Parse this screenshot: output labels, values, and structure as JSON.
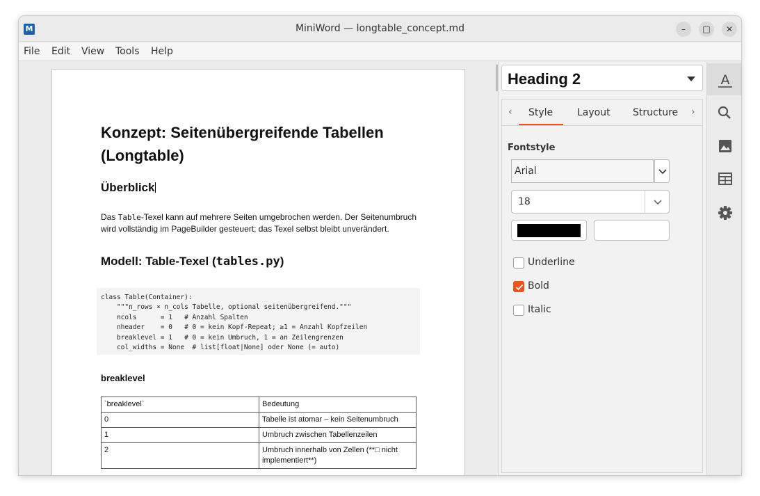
{
  "window": {
    "title": "MiniWord — longtable_concept.md",
    "app_icon_letter": "M",
    "minimize_symbol": "–",
    "maximize_symbol": "□",
    "close_symbol": "✕"
  },
  "menu": {
    "items": [
      "File",
      "Edit",
      "View",
      "Tools",
      "Help"
    ]
  },
  "document": {
    "title": "Konzept: Seitenübergreifende Tabellen (Longtable)",
    "heading_overview": "Überblick",
    "para_1": "Das ",
    "para_code": "Table",
    "para_2": "-Texel kann auf mehrere Seiten umgebrochen werden. Der Seitenumbruch wird vollständig im PageBuilder gesteuert; das Texel selbst bleibt unverändert.",
    "heading_model_prefix": "Modell: Table-Texel (",
    "heading_model_code": "tables.py",
    "heading_model_suffix": ")",
    "code_block": "class Table(Container):\n    \"\"\"n_rows × n_cols Tabelle, optional seitenübergreifend.\"\"\"\n    ncols      = 1   # Anzahl Spalten\n    nheader    = 0   # 0 = kein Kopf-Repeat; ≥1 = Anzahl Kopfzeilen\n    breaklevel = 1   # 0 = kein Umbruch, 1 = an Zeilengrenzen\n    col_widths = None  # list[float|None] oder None (= auto)",
    "heading_breaklevel": "breaklevel",
    "table": {
      "header": [
        "`breaklevel`",
        "Bedeutung"
      ],
      "rows": [
        [
          "0",
          "Tabelle ist atomar – kein Seitenumbruch"
        ],
        [
          "1",
          "Umbruch zwischen Tabellenzeilen"
        ],
        [
          "2",
          "Umbruch innerhalb von Zellen (**□ nicht implementiert**)"
        ]
      ]
    }
  },
  "panel": {
    "paragraph_style": "Heading 2",
    "tabs": [
      "Style",
      "Layout",
      "Structure"
    ],
    "active_tab": "Style",
    "nav_prev": "‹",
    "nav_next": "›",
    "fontstyle_label": "Fontstyle",
    "font_family": "Arial",
    "font_size": "18",
    "text_color": "#000000",
    "checkboxes": [
      {
        "label": "Underline",
        "checked": false
      },
      {
        "label": "Bold",
        "checked": true
      },
      {
        "label": "Italic",
        "checked": false
      }
    ]
  },
  "sidebar": {
    "icons": [
      "text-style-icon",
      "search-icon",
      "image-icon",
      "table-icon",
      "gear-icon"
    ],
    "active": "text-style-icon"
  },
  "colors": {
    "accent": "#e95420",
    "titlebar": "#ebebeb",
    "page": "#ffffff"
  }
}
